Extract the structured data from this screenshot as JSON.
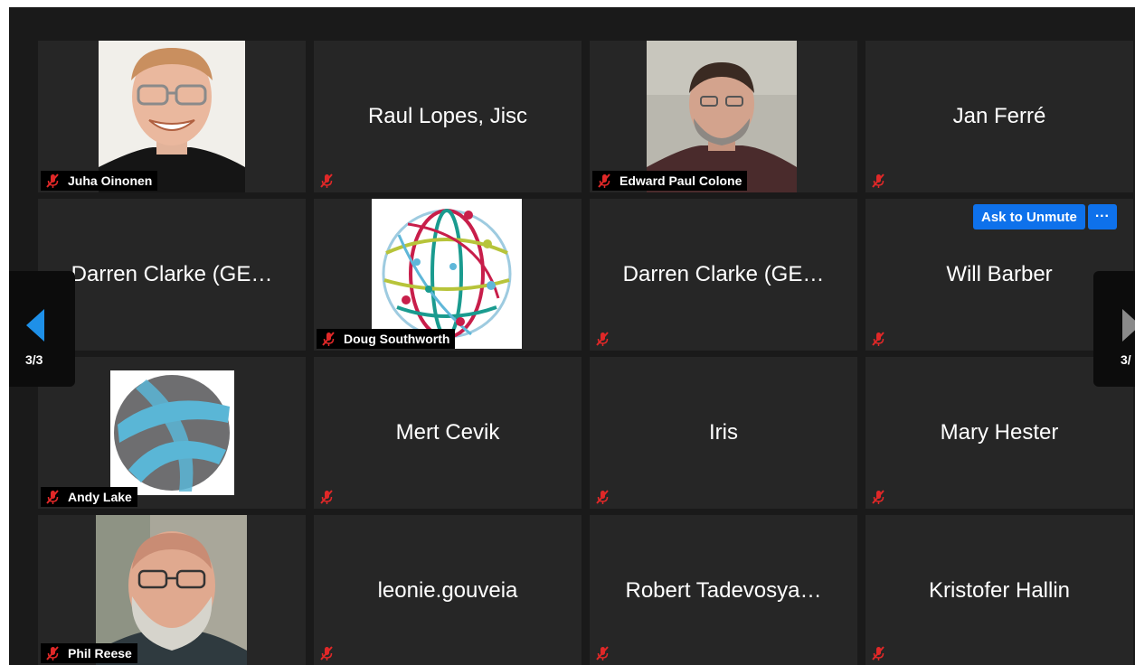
{
  "participants": [
    {
      "name": "Juha Oinonen"
    },
    {
      "name": "Raul Lopes, Jisc"
    },
    {
      "name": "Edward Paul Colone"
    },
    {
      "name": "Jan Ferré"
    },
    {
      "name": "Darren Clarke (GE…"
    },
    {
      "name": "Doug Southworth"
    },
    {
      "name": "Darren Clarke (GE…"
    },
    {
      "name": "Will Barber"
    },
    {
      "name": "Andy Lake"
    },
    {
      "name": "Mert Cevik"
    },
    {
      "name": "Iris"
    },
    {
      "name": "Mary Hester"
    },
    {
      "name": "Phil Reese"
    },
    {
      "name": "leonie.gouveia"
    },
    {
      "name": "Robert Tadevosya…"
    },
    {
      "name": "Kristofer Hallin"
    }
  ],
  "pager": {
    "left_count": "3/3",
    "right_count": "3/"
  },
  "hover_actions": {
    "ask_to_unmute": "Ask to Unmute",
    "more": "···"
  },
  "colors": {
    "accent": "#0e71eb",
    "muted_mic": "#e02828",
    "tile": "#262626",
    "background": "#1a1a1a"
  },
  "icons": {
    "mic": "microphone-muted-icon",
    "prev": "chevron-left-icon",
    "next": "chevron-right-icon"
  }
}
